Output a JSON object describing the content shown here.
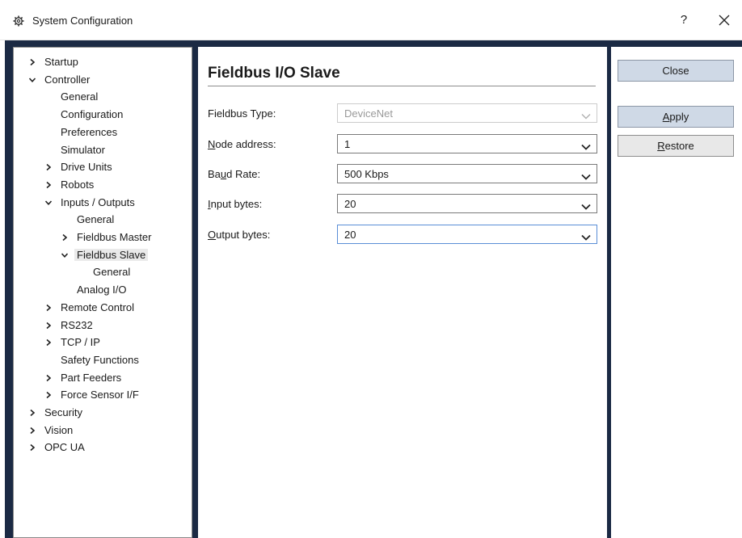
{
  "window": {
    "title": "System Configuration",
    "help_label": "?",
    "close_label": "✕",
    "icon": "gear-icon"
  },
  "tree": [
    {
      "label": "Startup",
      "expander": "collapsed",
      "indent": 0
    },
    {
      "label": "Controller",
      "expander": "expanded",
      "indent": 0
    },
    {
      "label": "General",
      "expander": "none",
      "indent": 1
    },
    {
      "label": "Configuration",
      "expander": "none",
      "indent": 1
    },
    {
      "label": "Preferences",
      "expander": "none",
      "indent": 1
    },
    {
      "label": "Simulator",
      "expander": "none",
      "indent": 1
    },
    {
      "label": "Drive Units",
      "expander": "collapsed",
      "indent": 1
    },
    {
      "label": "Robots",
      "expander": "collapsed",
      "indent": 1
    },
    {
      "label": "Inputs / Outputs",
      "expander": "expanded",
      "indent": 1
    },
    {
      "label": "General",
      "expander": "none",
      "indent": 2
    },
    {
      "label": "Fieldbus Master",
      "expander": "collapsed",
      "indent": 2
    },
    {
      "label": "Fieldbus Slave",
      "expander": "expanded",
      "indent": 2,
      "selected": true
    },
    {
      "label": "General",
      "expander": "none",
      "indent": 3
    },
    {
      "label": "Analog I/O",
      "expander": "none",
      "indent": 2
    },
    {
      "label": "Remote Control",
      "expander": "collapsed",
      "indent": 1
    },
    {
      "label": "RS232",
      "expander": "collapsed",
      "indent": 1
    },
    {
      "label": "TCP / IP",
      "expander": "collapsed",
      "indent": 1
    },
    {
      "label": "Safety Functions",
      "expander": "none",
      "indent": 1
    },
    {
      "label": "Part Feeders",
      "expander": "collapsed",
      "indent": 1
    },
    {
      "label": "Force Sensor I/F",
      "expander": "collapsed",
      "indent": 1
    },
    {
      "label": "Security",
      "expander": "collapsed",
      "indent": 0
    },
    {
      "label": "Vision",
      "expander": "collapsed",
      "indent": 0
    },
    {
      "label": "OPC UA",
      "expander": "collapsed",
      "indent": 0
    }
  ],
  "content": {
    "title": "Fieldbus I/O Slave",
    "fields": [
      {
        "label_pre": "Fieldbus Type:",
        "label_acc": "",
        "label_post": "",
        "value": "DeviceNet",
        "disabled": true
      },
      {
        "label_pre": "",
        "label_acc": "N",
        "label_post": "ode address:",
        "value": "1"
      },
      {
        "label_pre": "Ba",
        "label_acc": "u",
        "label_post": "d Rate:",
        "value": "500 Kbps"
      },
      {
        "label_pre": "",
        "label_acc": "I",
        "label_post": "nput bytes:",
        "value": "20"
      },
      {
        "label_pre": "",
        "label_acc": "O",
        "label_post": "utput bytes:",
        "value": "20",
        "focused": true
      }
    ]
  },
  "buttons": {
    "close": "Close",
    "apply_acc": "A",
    "apply_rest": "pply",
    "restore_acc": "R",
    "restore_rest": "estore"
  },
  "colors": {
    "frame": "#1b2a44",
    "primary_button": "#cfd9e6",
    "focus_border": "#5a8ed6"
  }
}
